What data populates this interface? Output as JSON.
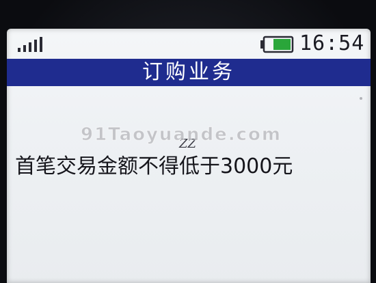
{
  "status_bar": {
    "time": "16:54",
    "signal_icon": "signal-strength-icon",
    "battery_icon": "battery-icon",
    "battery_level": 0.65
  },
  "title_bar": {
    "title": "订购业务"
  },
  "content": {
    "watermark": "91Taoyuande.com",
    "faint_text": "ZZ",
    "message": "首笔交易金额不得低于3000元"
  },
  "colors": {
    "title_bar_bg": "#1f2c8f",
    "battery_green": "#2aa63a",
    "screen_bg": "#f2f4f6"
  }
}
